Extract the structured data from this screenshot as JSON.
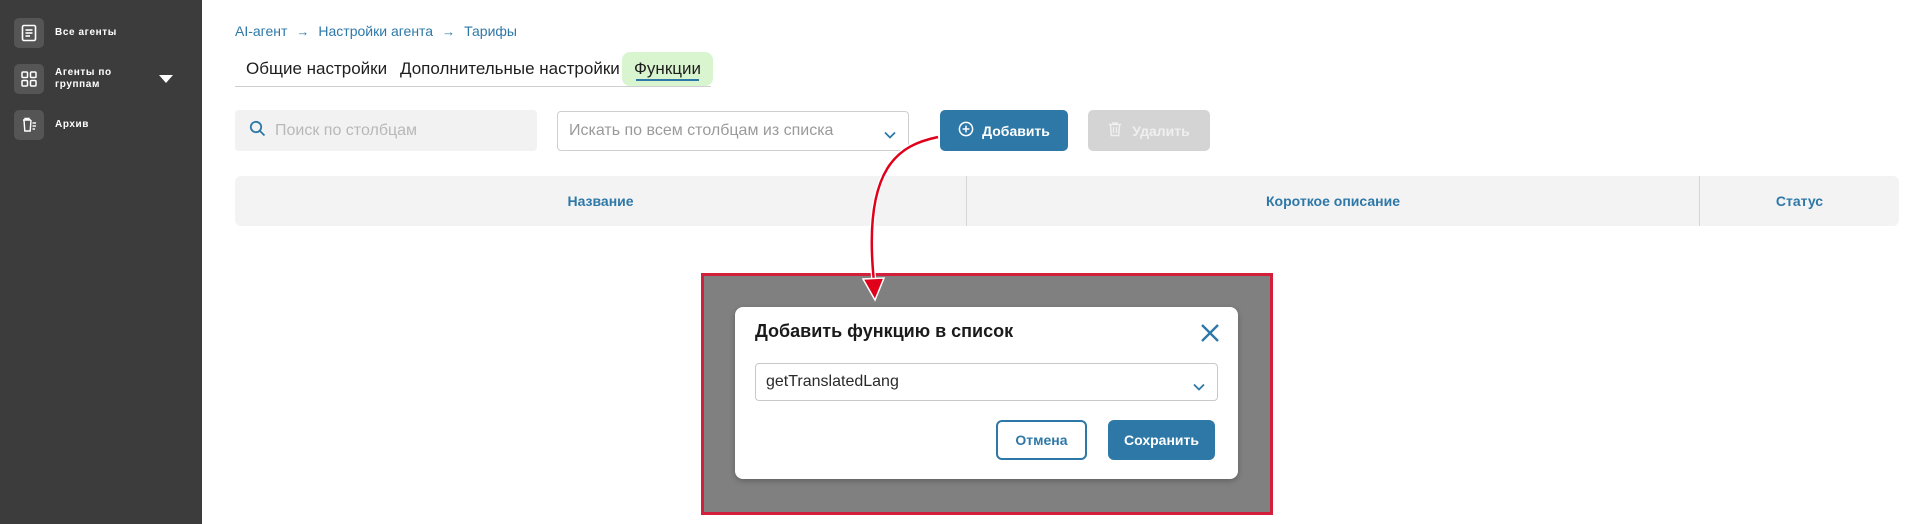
{
  "sidebar": {
    "items": [
      {
        "label": "Все агенты",
        "icon": "document-list-icon"
      },
      {
        "label": "Агенты по группам",
        "icon": "grid-icon",
        "has_dropdown": true
      },
      {
        "label": "Архив",
        "icon": "archive-trash-icon"
      }
    ]
  },
  "breadcrumb": [
    "AI-агент",
    "Настройки агента",
    "Тарифы"
  ],
  "tabs": [
    {
      "label": "Общие настройки"
    },
    {
      "label": "Дополнительные настройки"
    },
    {
      "label": "Функции",
      "active": true
    }
  ],
  "toolbar": {
    "search_placeholder": "Поиск по столбцам",
    "column_select_placeholder": "Искать по всем столбцам из списка",
    "add_label": "Добавить",
    "delete_label": "Удалить"
  },
  "table": {
    "columns": [
      "Название",
      "Короткое описание",
      "Статус"
    ]
  },
  "modal": {
    "title": "Добавить функцию в список",
    "selected_function": "getTranslatedLang",
    "cancel_label": "Отмена",
    "save_label": "Сохранить"
  },
  "colors": {
    "accent": "#2e78a8",
    "sidebar_bg": "#3c3c3c",
    "active_tab_bg": "#d8f5cf",
    "highlight_border": "#d41f3a",
    "annotation_arrow": "#e0001a"
  }
}
